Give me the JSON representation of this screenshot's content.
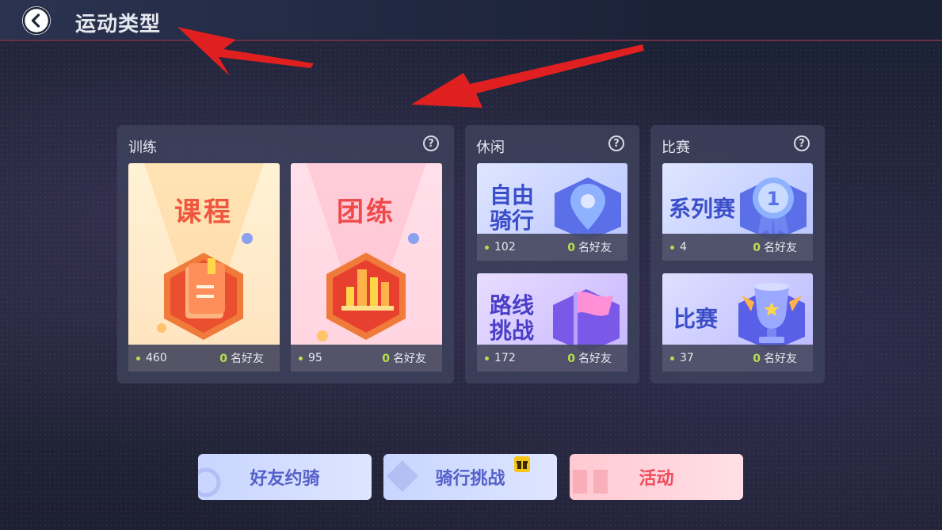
{
  "header": {
    "title": "运动类型"
  },
  "panels": {
    "training": {
      "title": "训练",
      "cards": [
        {
          "title": "课程",
          "count": "460",
          "friends": "0",
          "friends_label": "名好友"
        },
        {
          "title": "团练",
          "count": "95",
          "friends": "0",
          "friends_label": "名好友"
        }
      ]
    },
    "leisure": {
      "title": "休闲",
      "cards": [
        {
          "title_line1": "自由",
          "title_line2": "骑行",
          "count": "102",
          "friends": "0",
          "friends_label": "名好友"
        },
        {
          "title_line1": "路线",
          "title_line2": "挑战",
          "count": "172",
          "friends": "0",
          "friends_label": "名好友"
        }
      ]
    },
    "race": {
      "title": "比赛",
      "cards": [
        {
          "title": "系列赛",
          "count": "4",
          "friends": "0",
          "friends_label": "名好友"
        },
        {
          "title": "比赛",
          "count": "37",
          "friends": "0",
          "friends_label": "名好友"
        }
      ]
    }
  },
  "bottom": {
    "friend_ride": "好友约骑",
    "ride_challenge": "骑行挑战",
    "activity": "活动"
  },
  "colors": {
    "accent_green": "#b6e04b",
    "course_red": "#f0553d",
    "leisure_blue": "#3a4ec9",
    "activity_red": "#ee4a5a"
  }
}
